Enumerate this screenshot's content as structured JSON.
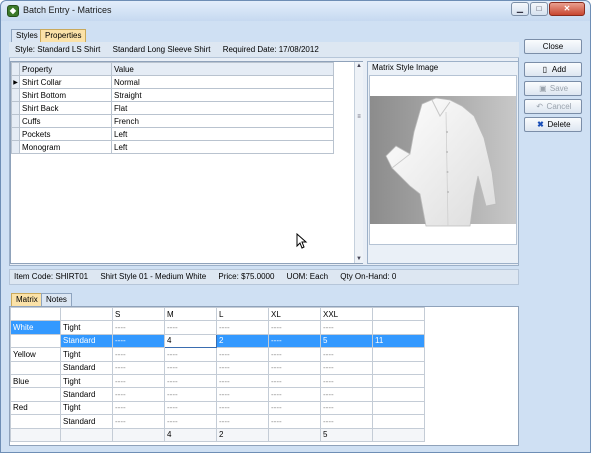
{
  "window": {
    "title": "Batch Entry - Matrices"
  },
  "top_tabs": [
    {
      "label": "Styles",
      "active": false
    },
    {
      "label": "Properties",
      "active": true
    }
  ],
  "style_info": {
    "style": "Style: Standard LS Shirt",
    "description": "Standard Long Sleeve Shirt",
    "required_date": "Required Date: 17/08/2012"
  },
  "properties": {
    "columns": [
      "Property",
      "Value"
    ],
    "rows": [
      {
        "property": "Shirt Collar",
        "value": "Normal"
      },
      {
        "property": "Shirt Bottom",
        "value": "Straight"
      },
      {
        "property": "Shirt Back",
        "value": "Flat"
      },
      {
        "property": "Cuffs",
        "value": "French"
      },
      {
        "property": "Pockets",
        "value": "Left"
      },
      {
        "property": "Monogram",
        "value": "Left"
      }
    ]
  },
  "image_panel": {
    "label": "Matrix Style Image"
  },
  "side_buttons": {
    "close": "Close",
    "add": "Add",
    "save": "Save",
    "cancel": "Cancel",
    "delete": "Delete"
  },
  "item_info": {
    "item_code": "Item Code: SHIRT01",
    "description": "Shirt Style 01 - Medium White",
    "price": "Price: $75.0000",
    "uom": "UOM: Each",
    "qty": "Qty On-Hand: 0"
  },
  "bottom_tabs": [
    {
      "label": "Matrix",
      "active": true
    },
    {
      "label": "Notes",
      "active": false
    }
  ],
  "matrix": {
    "sizes": [
      "S",
      "M",
      "L",
      "XL",
      "XXL"
    ],
    "rows": [
      {
        "group": "White",
        "sub": "Tight",
        "cells": [
          "----",
          "----",
          "----",
          "----",
          "----"
        ],
        "total": ""
      },
      {
        "group": "",
        "sub": "Standard",
        "cells": [
          "----",
          "4",
          "2",
          "----",
          "5"
        ],
        "total": "11"
      },
      {
        "group": "Yellow",
        "sub": "Tight",
        "cells": [
          "----",
          "----",
          "----",
          "----",
          "----"
        ],
        "total": ""
      },
      {
        "group": "",
        "sub": "Standard",
        "cells": [
          "----",
          "----",
          "----",
          "----",
          "----"
        ],
        "total": ""
      },
      {
        "group": "Blue",
        "sub": "Tight",
        "cells": [
          "----",
          "----",
          "----",
          "----",
          "----"
        ],
        "total": ""
      },
      {
        "group": "",
        "sub": "Standard",
        "cells": [
          "----",
          "----",
          "----",
          "----",
          "----"
        ],
        "total": ""
      },
      {
        "group": "Red",
        "sub": "Tight",
        "cells": [
          "----",
          "----",
          "----",
          "----",
          "----"
        ],
        "total": ""
      },
      {
        "group": "",
        "sub": "Standard",
        "cells": [
          "----",
          "----",
          "----",
          "----",
          "----"
        ],
        "total": ""
      }
    ],
    "totals": [
      "",
      "4",
      "2",
      "",
      "5"
    ],
    "selected_row": 1,
    "editing_column": 1
  },
  "colors": {
    "selection": "#3399ff",
    "active_tab": "#fbe2a8",
    "window_bg": "#cfe0f3"
  }
}
